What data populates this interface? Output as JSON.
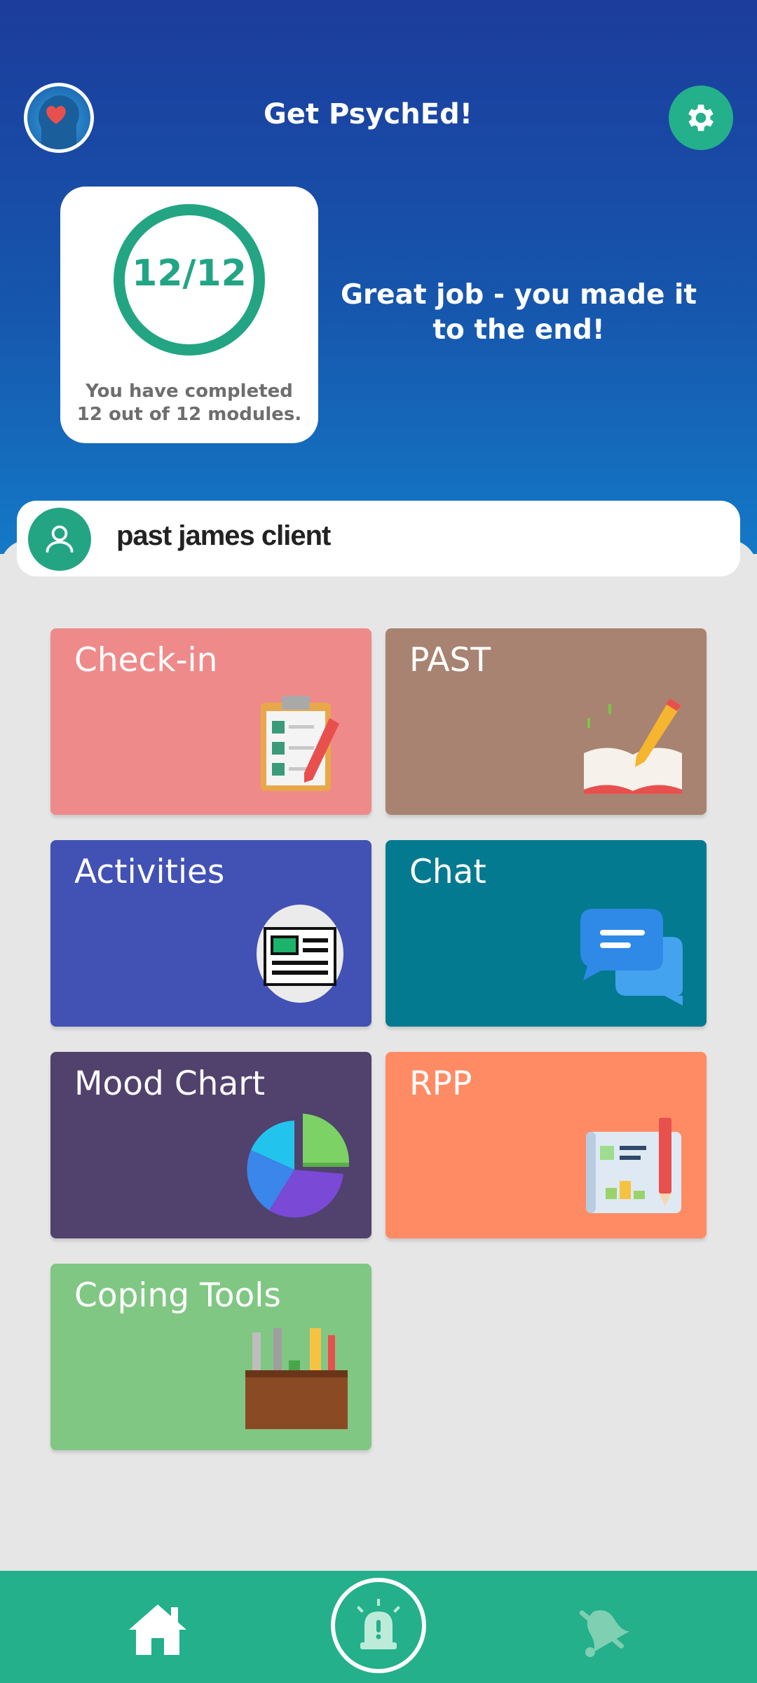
{
  "header": {
    "title": "Get PsychEd!",
    "logo_icon": "brain-heart-logo-icon",
    "settings_icon": "gear-icon"
  },
  "progress": {
    "display": "12/12",
    "completed": 12,
    "total": 12,
    "caption": "You have completed 12 out of 12 modules.",
    "message": "Great job - you made it to the end!"
  },
  "user": {
    "name": "past james client",
    "avatar_icon": "person-icon"
  },
  "tiles": [
    {
      "label": "Check-in",
      "icon": "clipboard-checklist-icon",
      "color": "#ef8a8a"
    },
    {
      "label": "PAST",
      "icon": "book-pencil-icon",
      "color": "#a88371"
    },
    {
      "label": "Activities",
      "icon": "newspaper-icon",
      "color": "#4251b4"
    },
    {
      "label": "Chat",
      "icon": "chat-bubbles-icon",
      "color": "#037a8f"
    },
    {
      "label": "Mood Chart",
      "icon": "pie-chart-icon",
      "color": "#51416d"
    },
    {
      "label": "RPP",
      "icon": "blueprint-icon",
      "color": "#ff8b65"
    },
    {
      "label": "Coping Tools",
      "icon": "toolbox-icon",
      "color": "#80c783"
    }
  ],
  "bottom_nav": {
    "items": [
      {
        "icon": "home-icon",
        "active": true
      },
      {
        "icon": "alarm-siren-icon",
        "active": false
      },
      {
        "icon": "bell-muted-icon",
        "active": false
      }
    ],
    "background": "#23b08a"
  },
  "colors": {
    "accent": "#23b08a",
    "header_top": "#1c3c9c",
    "header_bottom": "#1479c7"
  }
}
